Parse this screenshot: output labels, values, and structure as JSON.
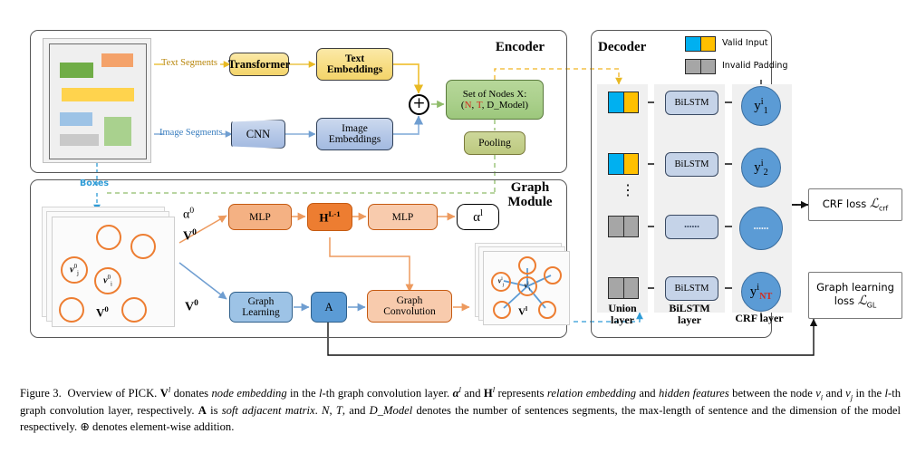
{
  "figure": {
    "caption_prefix": "Figure 3.",
    "caption_text": "Overview of PICK. V^l donates node embedding in the l-th graph convolution layer. α^l and H^l represents relation embedding and hidden features between the node v_i and v_j in the l-th graph convolution layer, respectively. A is soft adjacent matrix. N, T, and D_Model denotes the number of sentences segments, the max-length of sentence and the dimension of the model respectively. ⊕ denotes element-wise addition."
  },
  "panels": {
    "encoder": {
      "title": "Encoder"
    },
    "graph_module": {
      "title_line1": "Graph",
      "title_line2": "Module"
    },
    "decoder": {
      "title": "Decoder"
    }
  },
  "encoder": {
    "document_segments": [
      {
        "color": "#f4a26a",
        "name": "segment-orange"
      },
      {
        "color": "#70ad47",
        "name": "segment-green-1"
      },
      {
        "color": "#ffd34d",
        "name": "segment-yellow"
      },
      {
        "color": "#9dc3e6",
        "name": "segment-blue"
      },
      {
        "color": "#a9d18e",
        "name": "segment-green-2"
      },
      {
        "color": "#c9c9c9",
        "name": "segment-gray"
      }
    ],
    "arrow_text_label": "Text Segments",
    "arrow_image_label": "Image Segments",
    "transformer": "Transformer",
    "cnn": "CNN",
    "text_embeddings_line1": "Text",
    "text_embeddings_line2": "Embeddings",
    "image_embeddings_line1": "Image",
    "image_embeddings_line2": "Embeddings",
    "plus_symbol": "⊕",
    "set_of_nodes_line1": "Set of Nodes X:",
    "set_of_nodes_N": "N",
    "set_of_nodes_T": "T",
    "set_of_nodes_D": "D_Model",
    "pooling": "Pooling",
    "boxes_label": "Boxes"
  },
  "graph_module": {
    "alpha0": "α",
    "alpha0_sup": "0",
    "alphal": "α",
    "alphal_sup": "l",
    "v0_upper": "V",
    "v0_upper_sup": "0",
    "v0_lower": "V",
    "v0_lower_sup": "0",
    "mlp_left": "MLP",
    "mlp_right": "MLP",
    "h_symbol": "H",
    "h_sup": "L-1",
    "graph_learning_line1": "Graph",
    "graph_learning_line2": "Learning",
    "a_matrix": "A",
    "graph_conv_line1": "Graph",
    "graph_conv_line2": "Convolution",
    "node_card_in_label": "V",
    "node_card_in_sup": "0",
    "node_vi_in": "v",
    "node_vi_in_sub": "i",
    "node_vi_in_sup": "0",
    "node_vj_in": "v",
    "node_vj_in_sub": "j",
    "node_vj_in_sup": "0",
    "node_card_out_label": "V",
    "node_card_out_sup": "l",
    "node_vi_out": "v",
    "node_vi_out_sub": "i",
    "node_vi_out_sup": "l",
    "node_vj_out": "v",
    "node_vj_out_sub": "j",
    "node_vj_out_sup": "l"
  },
  "decoder": {
    "legend": [
      {
        "label": "Valid Input",
        "color_left": "#00b0f0",
        "color_right": "#ffc000"
      },
      {
        "label": "Invalid Padding",
        "color_left": "#a6a6a6",
        "color_right": "#a6a6a6"
      }
    ],
    "union_tokens": [
      {
        "type": "valid"
      },
      {
        "type": "valid"
      },
      {
        "type": "invalid"
      },
      {
        "type": "invalid"
      }
    ],
    "vdots": "⋮",
    "bilstm_cells": [
      "BiLSTM",
      "BiLSTM",
      "••••••",
      "BiLSTM"
    ],
    "crf_nodes": [
      {
        "base": "y",
        "sup": "i",
        "sub": "1",
        "sub_color": "#000000"
      },
      {
        "base": "y",
        "sup": "i",
        "sub": "2",
        "sub_color": "#000000"
      },
      {
        "base": "••••••",
        "sup": "",
        "sub": "",
        "sub_color": "#000000"
      },
      {
        "base": "y",
        "sup": "i",
        "sub": "NT",
        "sub_color": "#c00000"
      }
    ],
    "col_labels": [
      {
        "line1": "Union",
        "line2": "layer"
      },
      {
        "line1": "BiLSTM",
        "line2": "layer"
      },
      {
        "line1": "CRF layer",
        "line2": ""
      }
    ]
  },
  "losses": {
    "crf_loss_text": "CRF loss",
    "crf_loss_sym": "ℒ",
    "crf_loss_sub": "crf",
    "graph_loss_line1": "Graph learning",
    "graph_loss_line2_text": "loss",
    "graph_loss_sym": "ℒ",
    "graph_loss_sub": "GL"
  },
  "colors": {
    "orange": "#ed7d31",
    "orange_light": "#f4b183",
    "blue": "#5b9bd5",
    "steel": "#9dc3e6",
    "yellow": "#ffc000",
    "green": "#a9d18e",
    "gray_border": "#575757",
    "red": "#c00000",
    "cyan": "#00b0f0"
  }
}
